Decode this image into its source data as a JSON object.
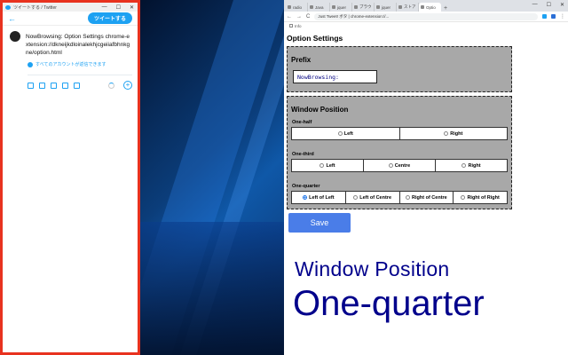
{
  "twitter": {
    "window_title": "ツイートする / Twitter",
    "win_min": "—",
    "win_max": "☐",
    "win_close": "✕",
    "back": "←",
    "tweet_button": "ツイートする",
    "tweet_text": "NowBrowsing: Option Settings chrome-extension://dkneijkdloinalekhjcgeiiafbhnkgne/option.html",
    "reply_setting": "すべてのアカウントが返信できます",
    "add": "+"
  },
  "chrome": {
    "tabs": [
      {
        "label": "radio"
      },
      {
        "label": "Java"
      },
      {
        "label": "jquer"
      },
      {
        "label": "ブラウ"
      },
      {
        "label": "jquer"
      },
      {
        "label": "ストア"
      },
      {
        "label": "Optio"
      }
    ],
    "new_tab": "+",
    "win_min": "—",
    "win_max": "☐",
    "win_close": "✕",
    "nav_back": "←",
    "nav_forward": "→",
    "reload": "C",
    "address": "Just Tweet! ボタ | chrome-extension://...",
    "bookmark": "Info"
  },
  "options": {
    "title": "Option Settings",
    "prefix": {
      "heading": "Prefix",
      "value": "NowBrowsing:"
    },
    "window_position": {
      "heading": "Window Position",
      "groups": [
        {
          "label": "One-half",
          "options": [
            "Left",
            "Right"
          ],
          "selected": null
        },
        {
          "label": "One-third",
          "options": [
            "Left",
            "Centre",
            "Right"
          ],
          "selected": null
        },
        {
          "label": "One-quarter",
          "options": [
            "Left of Left",
            "Left of Centre",
            "Right of Centre",
            "Right of Right"
          ],
          "selected": 0
        }
      ]
    },
    "save_label": "Save"
  },
  "overlay": {
    "line1": "Window Position",
    "line2": "One-quarter"
  },
  "colors": {
    "twitter_border": "#e8321f",
    "twitter_blue": "#1da1f2",
    "section_bg": "#a8a8a8",
    "save_button": "#4a7de8",
    "overlay_text": "#00008b"
  }
}
